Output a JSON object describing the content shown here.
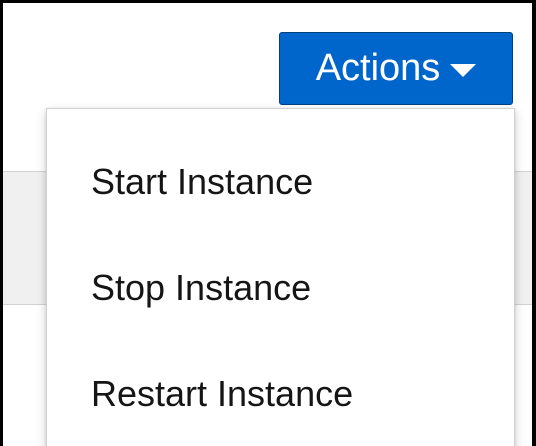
{
  "toolbar": {
    "actions_label": "Actions",
    "actions_icon": "caret-down-icon",
    "accent_color": "#0066cc"
  },
  "menu": {
    "items": [
      {
        "label": "Start Instance"
      },
      {
        "label": "Stop Instance"
      },
      {
        "label": "Restart Instance"
      }
    ]
  }
}
